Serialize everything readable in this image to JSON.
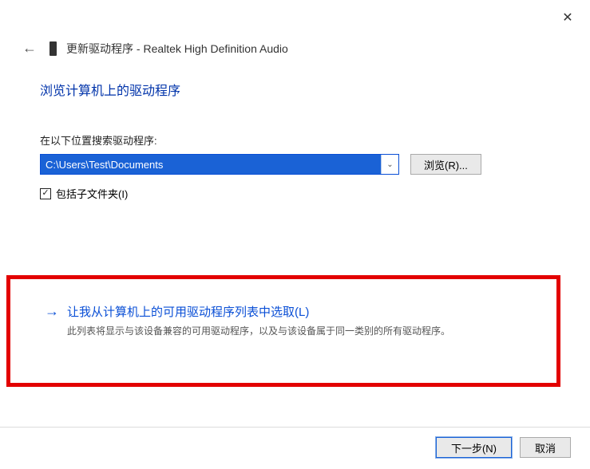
{
  "window": {
    "title_prefix": "更新驱动程序",
    "title_device": "Realtek High Definition Audio"
  },
  "page": {
    "title": "浏览计算机上的驱动程序",
    "search_label": "在以下位置搜索驱动程序:",
    "path_value": "C:\\Users\\Test\\Documents",
    "browse_label": "浏览(R)...",
    "include_subfolders_label": "包括子文件夹(I)"
  },
  "option": {
    "title": "让我从计算机上的可用驱动程序列表中选取(L)",
    "description": "此列表将显示与该设备兼容的可用驱动程序，以及与该设备属于同一类别的所有驱动程序。"
  },
  "footer": {
    "next": "下一步(N)",
    "cancel": "取消"
  }
}
